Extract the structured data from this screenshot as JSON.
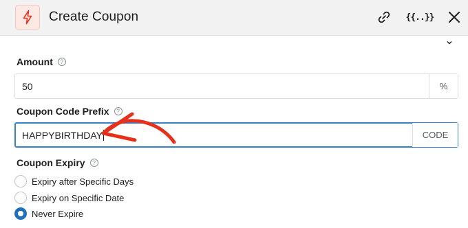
{
  "header": {
    "title": "Create Coupon",
    "icons": [
      "lightning-icon",
      "link-icon",
      "smart-tags-icon",
      "close-icon"
    ],
    "smart_tags_glyph": "{{..}}"
  },
  "amount": {
    "label": "Amount",
    "value": "50",
    "suffix": "%"
  },
  "coupon_code_prefix": {
    "label": "Coupon Code Prefix",
    "value": "HAPPYBIRTHDAY",
    "suffix": "CODE"
  },
  "coupon_expiry": {
    "label": "Coupon Expiry",
    "options": [
      {
        "label": "Expiry after Specific Days",
        "checked": false
      },
      {
        "label": "Expiry on Specific Date",
        "checked": false
      },
      {
        "label": "Never Expire",
        "checked": true
      }
    ]
  },
  "help_glyph": "?",
  "colors": {
    "accent_red": "#e5301c",
    "focus_blue": "#3582c4",
    "radio_checked": "#1f6fbf"
  }
}
